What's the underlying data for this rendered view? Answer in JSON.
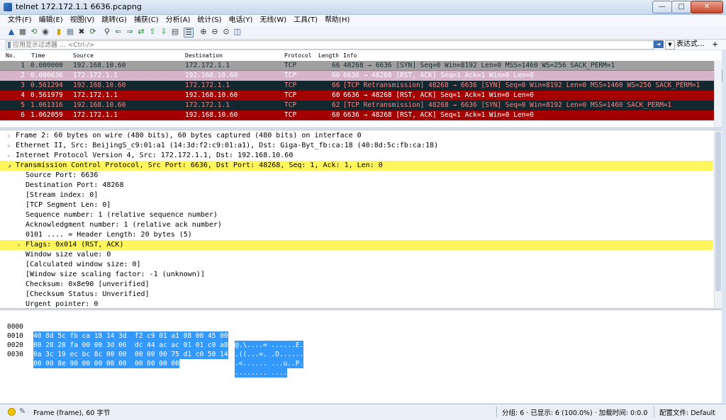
{
  "window": {
    "title": "telnet 172.172.1.1 6636.pcapng"
  },
  "menu": [
    "文件(F)",
    "编辑(E)",
    "视图(V)",
    "跳转(G)",
    "捕获(C)",
    "分析(A)",
    "统计(S)",
    "电话(Y)",
    "无线(W)",
    "工具(T)",
    "帮助(H)"
  ],
  "filter": {
    "placeholder": "应用显示过滤器 … <Ctrl-/>",
    "expression_label": "表达式…",
    "add_label": "+"
  },
  "packet_list": {
    "columns": [
      "No.",
      "Time",
      "Source",
      "Destination",
      "Protocol",
      "Length",
      "Info"
    ],
    "rows": [
      {
        "no": "1",
        "time": "0.000000",
        "source": "192.168.10.60",
        "destination": "172.172.1.1",
        "protocol": "TCP",
        "length": "66",
        "info": "48268 → 6636 [SYN] Seq=0 Win=8192 Len=0 MSS=1460 WS=256 SACK_PERM=1",
        "bg": "#a0a0a0",
        "fg": "#12272e"
      },
      {
        "no": "2",
        "time": "0.000636",
        "source": "172.172.1.1",
        "destination": "192.168.10.60",
        "protocol": "TCP",
        "length": "60",
        "info": "6636 → 48268 [RST, ACK] Seq=1 Ack=1 Win=0 Len=0",
        "bg": "#d8b4c8",
        "fg": "#fffcfc",
        "selected": true
      },
      {
        "no": "3",
        "time": "0.561294",
        "source": "192.168.10.60",
        "destination": "172.172.1.1",
        "protocol": "TCP",
        "length": "66",
        "info": "[TCP Retransmission] 48268 → 6636 [SYN] Seq=0 Win=8192 Len=0 MSS=1460 WS=256 SACK_PERM=1",
        "bg": "#12272e",
        "fg": "#f78787"
      },
      {
        "no": "4",
        "time": "0.561979",
        "source": "172.172.1.1",
        "destination": "192.168.10.60",
        "protocol": "TCP",
        "length": "60",
        "info": "6636 → 48268 [RST, ACK] Seq=1 Ack=1 Win=0 Len=0",
        "bg": "#a40000",
        "fg": "#fffcfc"
      },
      {
        "no": "5",
        "time": "1.061316",
        "source": "192.168.10.60",
        "destination": "172.172.1.1",
        "protocol": "TCP",
        "length": "62",
        "info": "[TCP Retransmission] 48268 → 6636 [SYN] Seq=0 Win=8192 Len=0 MSS=1460 SACK_PERM=1",
        "bg": "#12272e",
        "fg": "#f78787"
      },
      {
        "no": "6",
        "time": "1.062059",
        "source": "172.172.1.1",
        "destination": "192.168.10.60",
        "protocol": "TCP",
        "length": "60",
        "info": "6636 → 48268 [RST, ACK] Seq=1 Ack=1 Win=0 Len=0",
        "bg": "#a40000",
        "fg": "#fffcfc"
      }
    ]
  },
  "details": [
    {
      "text": "Frame 2: 60 bytes on wire (480 bits), 60 bytes captured (480 bits) on interface 0",
      "level": 0,
      "expander": "collapsed"
    },
    {
      "text": "Ethernet II, Src: BeijingS_c9:01:a1 (14:3d:f2:c9:01:a1), Dst: Giga-Byt_fb:ca:18 (40:8d:5c:fb:ca:18)",
      "level": 0,
      "expander": "collapsed"
    },
    {
      "text": "Internet Protocol Version 4, Src: 172.172.1.1, Dst: 192.168.10.60",
      "level": 0,
      "expander": "collapsed"
    },
    {
      "text": "Transmission Control Protocol, Src Port: 6636, Dst Port: 48268, Seq: 1, Ack: 1, Len: 0",
      "level": 0,
      "expander": "expanded",
      "highlight": true
    },
    {
      "text": "Source Port: 6636",
      "level": 1
    },
    {
      "text": "Destination Port: 48268",
      "level": 1
    },
    {
      "text": "[Stream index: 0]",
      "level": 1
    },
    {
      "text": "[TCP Segment Len: 0]",
      "level": 1
    },
    {
      "text": "Sequence number: 1    (relative sequence number)",
      "level": 1
    },
    {
      "text": "Acknowledgment number: 1    (relative ack number)",
      "level": 1
    },
    {
      "text": "0101 .... = Header Length: 20 bytes (5)",
      "level": 1
    },
    {
      "text": "Flags: 0x014 (RST, ACK)",
      "level": 1,
      "expander": "collapsed",
      "highlight": true
    },
    {
      "text": "Window size value: 0",
      "level": 1
    },
    {
      "text": "[Calculated window size: 0]",
      "level": 1
    },
    {
      "text": "[Window size scaling factor: -1 (unknown)]",
      "level": 1
    },
    {
      "text": "Checksum: 0x8e90 [unverified]",
      "level": 1
    },
    {
      "text": "[Checksum Status: Unverified]",
      "level": 1
    },
    {
      "text": "Urgent pointer: 0",
      "level": 1
    }
  ],
  "hex": [
    {
      "offset": "0000",
      "bytes": "40 8d 5c fb ca 18 14 3d  f2 c9 01 a1 08 00 45 00",
      "ascii": "@.\\....= ......E."
    },
    {
      "offset": "0010",
      "bytes": "00 28 28 fa 00 00 3d 06  dc 44 ac ac 01 01 c0 a8",
      "ascii": ".((...=. .D......"
    },
    {
      "offset": "0020",
      "bytes": "0a 3c 19 ec bc 8c 00 00  00 00 00 75 d1 c0 50 14",
      "ascii": ".<...... ...u..P."
    },
    {
      "offset": "0030",
      "bytes": "00 00 8e 90 00 00 00 00  00 00 00 00",
      "ascii": "........ ...."
    }
  ],
  "status": {
    "frame": "Frame (frame), 60 字节",
    "packets": "分组: 6 · 已显示: 6 (100.0%) · 加载时间: 0:0.0",
    "profile": "配置文件: Default"
  }
}
